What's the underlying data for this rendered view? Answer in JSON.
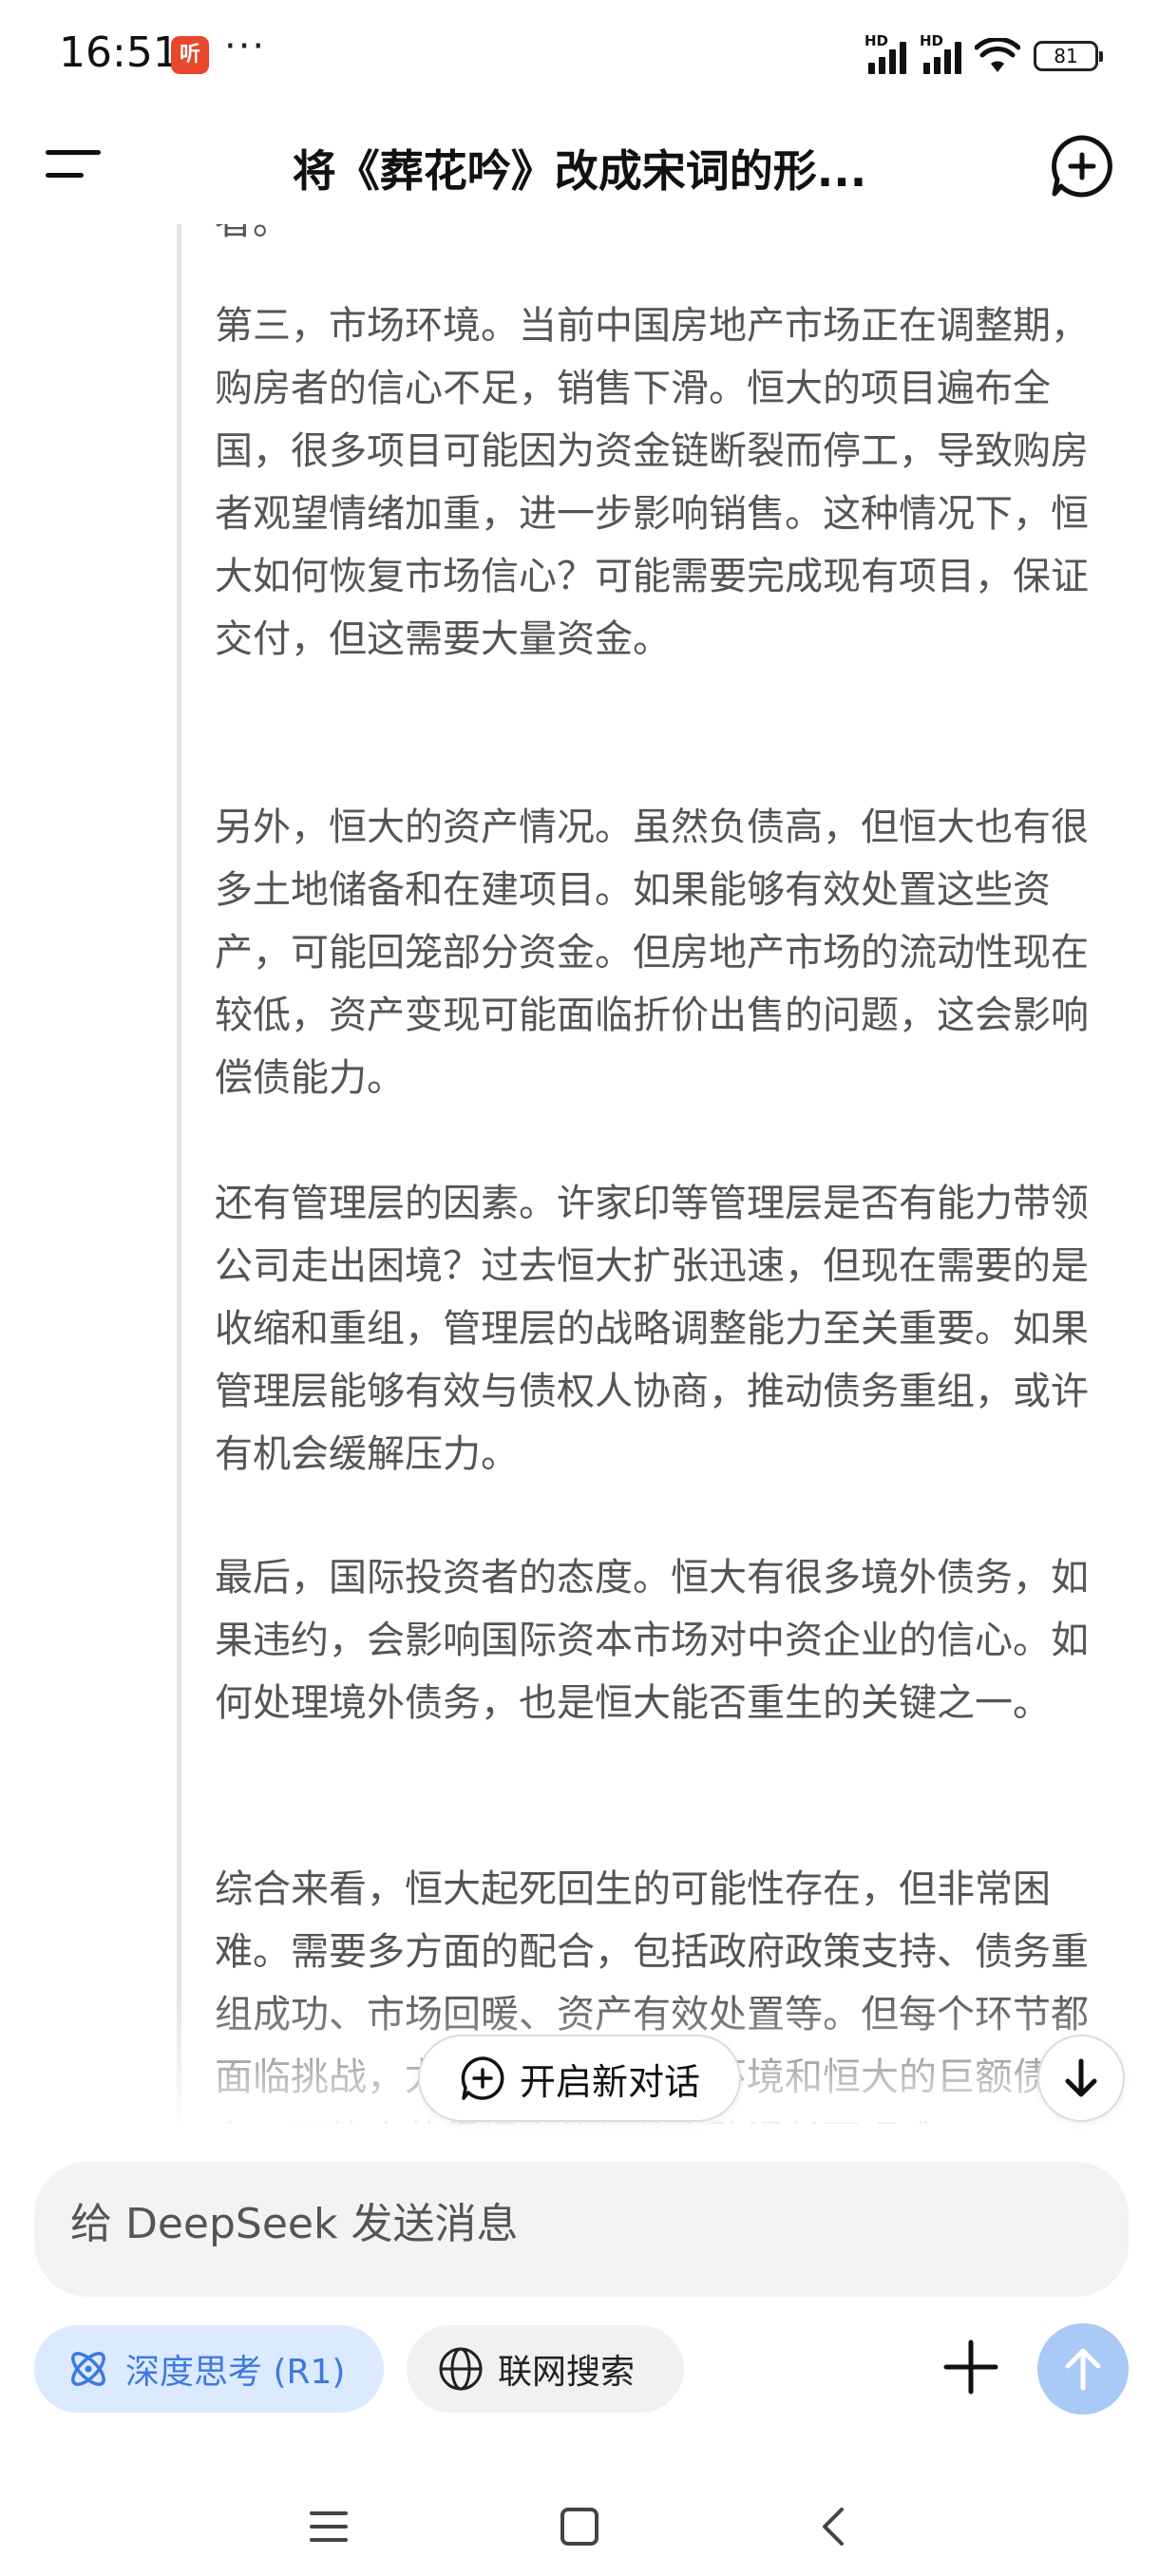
{
  "status_bar": {
    "time": "16:51",
    "app_icon_text": "听",
    "overflow_dots": "···",
    "signal_1_label": "HD",
    "signal_2_label": "HD",
    "battery": "81"
  },
  "header": {
    "title": "将《葬花吟》改成宋词的形..."
  },
  "conversation": {
    "top_cut_text": "者。",
    "paragraphs": [
      "第三，市场环境。当前中国房地产市场正在调整期，购房者的信心不足，销售下滑。恒大的项目遍布全国，很多项目可能因为资金链断裂而停工，导致购房者观望情绪加重，进一步影响销售。这种情况下，恒大如何恢复市场信心？可能需要完成现有项目，保证交付，但这需要大量资金。",
      "另外，恒大的资产情况。虽然负债高，但恒大也有很多土地储备和在建项目。如果能够有效处置这些资产，可能回笼部分资金。但房地产市场的流动性现在较低，资产变现可能面临折价出售的问题，这会影响偿债能力。",
      "还有管理层的因素。许家印等管理层是否有能力带领公司走出困境？过去恒大扩张迅速，但现在需要的是收缩和重组，管理层的战略调整能力至关重要。如果管理层能够有效与债权人协商，推动债务重组，或许有机会缓解压力。",
      "最后，国际投资者的态度。恒大有很多境外债务，如果违约，会影响国际资本市场对中资企业的信心。如何处理境外债务，也是恒大能否重生的关键之一。",
      "综合来看，恒大起死回生的可能性存在，但非常困难。需要多方面的配合，包括政府政策支持、债务重组成功、市场回暖、资产有效处置等。但每个环节都面临挑战，尤其是当前的市场环境和恒大的巨额债务，可能会使得恒大的复苏之路漫长而艰难。"
    ]
  },
  "floating": {
    "new_dialog_label": "开启新对话"
  },
  "composer": {
    "placeholder": "给 DeepSeek 发送消息"
  },
  "toolbar": {
    "deep_think_label": "深度思考 (R1)",
    "web_search_label": "联网搜索"
  },
  "colors": {
    "accent": "#3d7ae0",
    "chip_active_bg": "#dbeafe",
    "send_button": "#a9c9f6",
    "body_text": "#555555"
  },
  "icons": [
    "menu-icon",
    "new-chat-icon",
    "chat-plus-icon",
    "arrow-down-icon",
    "atom-icon",
    "globe-icon",
    "plus-icon",
    "arrow-up-icon",
    "nav-menu-icon",
    "nav-home-icon",
    "nav-back-icon"
  ]
}
